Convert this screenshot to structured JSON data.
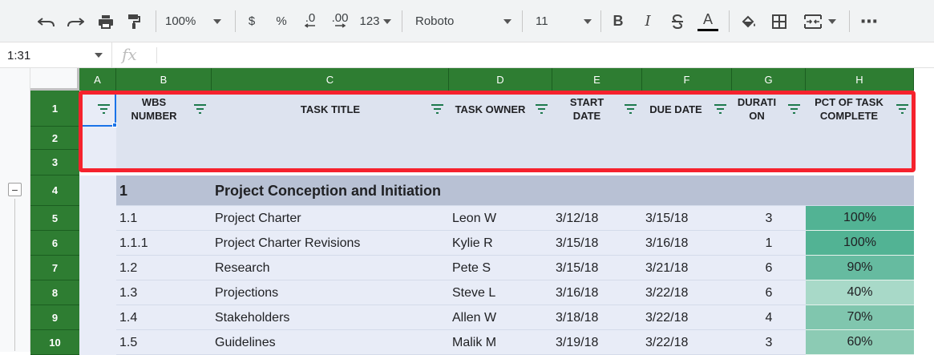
{
  "toolbar": {
    "zoom": "100%",
    "currency": "$",
    "percent": "%",
    "dec_decrease": ".0",
    "dec_increase": ".00",
    "number_format": "123",
    "font_name": "Roboto",
    "font_size": "11",
    "bold": "B",
    "italic": "I",
    "more": "⋯",
    "text_color_glyph": "A"
  },
  "formula_bar": {
    "cell_ref": "1:31",
    "fx": "fx",
    "value": ""
  },
  "columns": [
    "A",
    "B",
    "C",
    "D",
    "E",
    "F",
    "G",
    "H"
  ],
  "row_numbers": [
    "1",
    "2",
    "3",
    "4",
    "5",
    "6",
    "7",
    "8",
    "9",
    "10"
  ],
  "headers": {
    "wbs": "WBS NUMBER",
    "title": "TASK TITLE",
    "owner": "TASK OWNER",
    "start": "START DATE",
    "due": "DUE DATE",
    "duration": "DURATI ON",
    "pct": "PCT OF TASK COMPLETE"
  },
  "section": {
    "wbs": "1",
    "title": "Project Conception and Initiation"
  },
  "rows": [
    {
      "wbs": "1.1",
      "title": "Project Charter",
      "owner": "Leon W",
      "start": "3/12/18",
      "due": "3/15/18",
      "duration": "3",
      "pct": "100%",
      "pct_color": "#52b394"
    },
    {
      "wbs": "1.1.1",
      "title": "Project Charter Revisions",
      "owner": "Kylie R",
      "start": "3/15/18",
      "due": "3/16/18",
      "duration": "1",
      "pct": "100%",
      "pct_color": "#52b394"
    },
    {
      "wbs": "1.2",
      "title": "Research",
      "owner": "Pete S",
      "start": "3/15/18",
      "due": "3/21/18",
      "duration": "6",
      "pct": "90%",
      "pct_color": "#66bba0"
    },
    {
      "wbs": "1.3",
      "title": "Projections",
      "owner": "Steve L",
      "start": "3/16/18",
      "due": "3/22/18",
      "duration": "6",
      "pct": "40%",
      "pct_color": "#a8d9c8"
    },
    {
      "wbs": "1.4",
      "title": "Stakeholders",
      "owner": "Allen W",
      "start": "3/18/18",
      "due": "3/22/18",
      "duration": "4",
      "pct": "70%",
      "pct_color": "#80c6ae"
    },
    {
      "wbs": "1.5",
      "title": "Guidelines",
      "owner": "Malik M",
      "start": "3/19/18",
      "due": "3/22/18",
      "duration": "3",
      "pct": "60%",
      "pct_color": "#8ccbb4"
    }
  ],
  "colors": {
    "header_green": "#2e7d32",
    "header_band": "#dde3ef",
    "section_band": "#b8c1d4",
    "row_band": "#e8ecf7",
    "highlight": "#f5222d",
    "selection": "#1a73e8"
  }
}
